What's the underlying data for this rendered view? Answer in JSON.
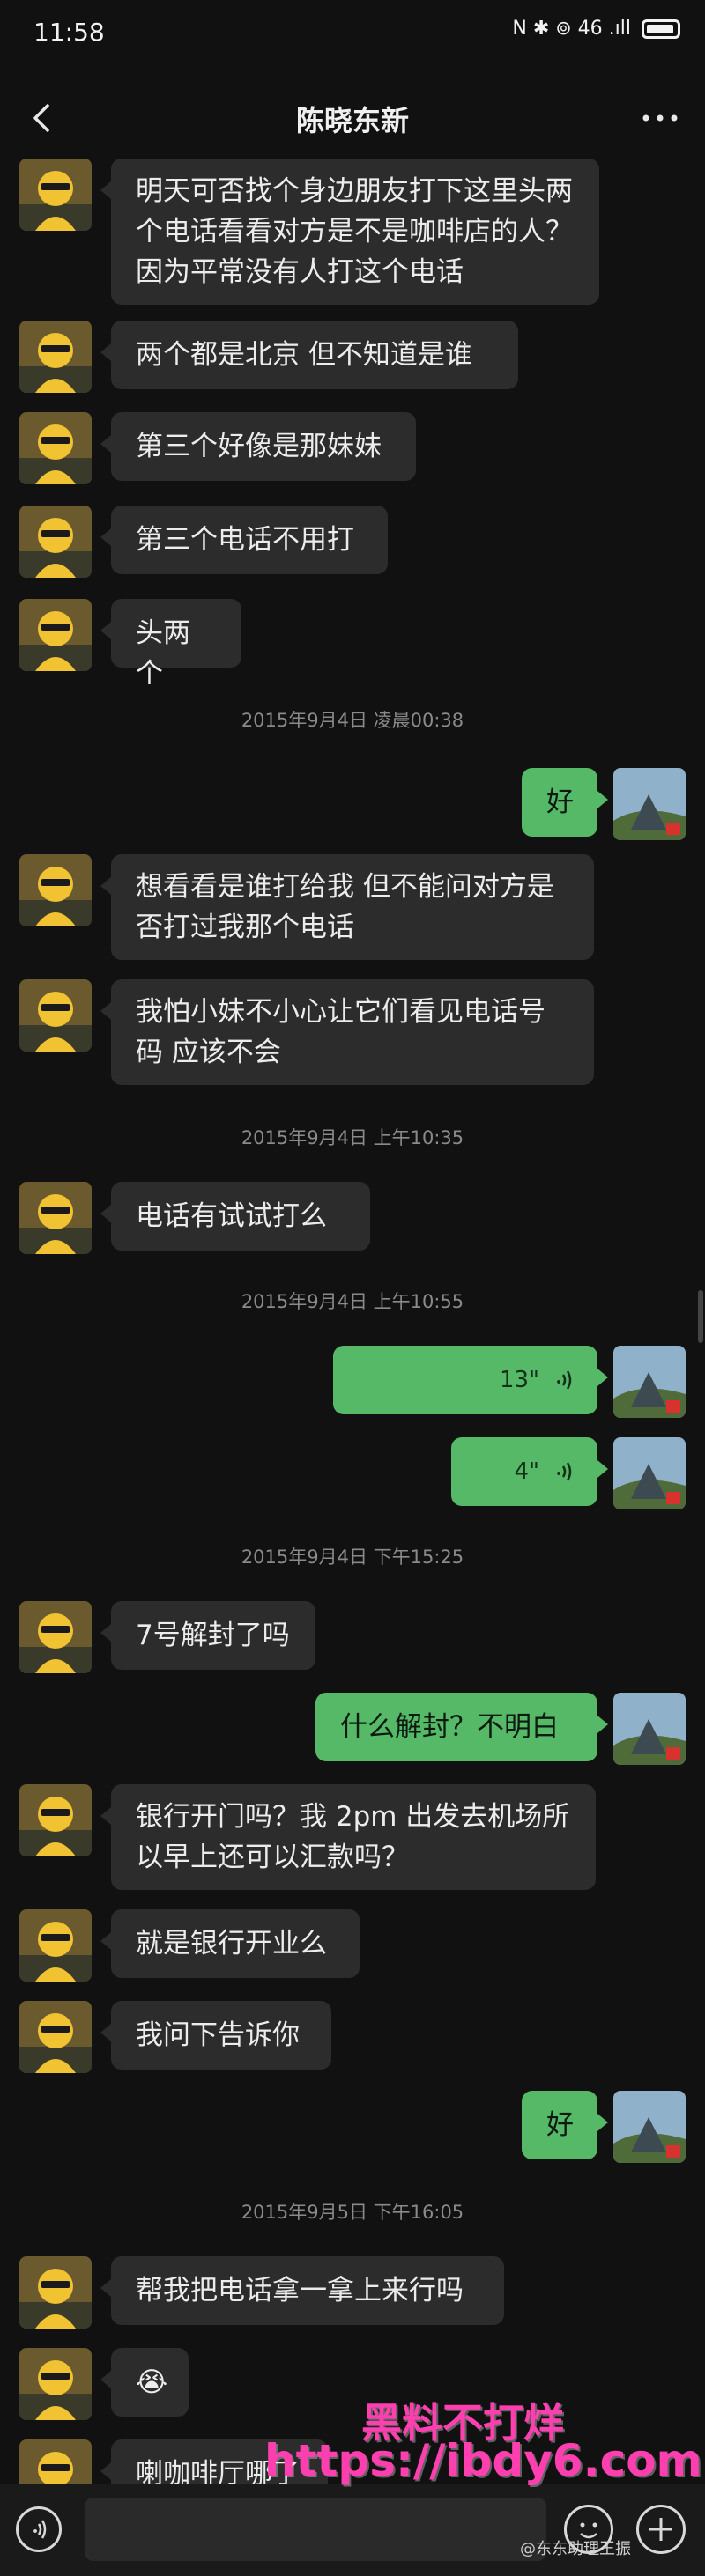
{
  "status": {
    "time": "11:58",
    "indicators": "N ✱ ⊚ 46 .ıll"
  },
  "header": {
    "title": "陈晓东新",
    "back_icon": "chevron-left-icon",
    "more_icon": "more-dots-icon"
  },
  "messages": [
    {
      "text": "明天可否找个身边朋友打下这里头两个电话看看对方是不是咖啡店的人？ 因为平常没有人打这个电话",
      "side": "left"
    },
    {
      "text": "两个都是北京  但不知道是谁",
      "side": "left"
    },
    {
      "text": "第三个好像是那妹妹",
      "side": "left"
    },
    {
      "text": "第三个电话不用打",
      "side": "left"
    },
    {
      "text": "头两个",
      "side": "left"
    },
    {
      "timestamp": "2015年9月4日  凌晨00:38"
    },
    {
      "text": "好",
      "side": "right"
    },
    {
      "text": "想看看是谁打给我  但不能问对方是否打过我那个电话",
      "side": "left"
    },
    {
      "text": "我怕小妹不小心让它们看见电话号码  应该不会",
      "side": "left"
    },
    {
      "timestamp": "2015年9月4日  上午10:35"
    },
    {
      "text": "电话有试试打么",
      "side": "left"
    },
    {
      "timestamp": "2015年9月4日  上午10:55"
    },
    {
      "voice": "13\"",
      "side": "right"
    },
    {
      "voice": "4\"",
      "side": "right"
    },
    {
      "timestamp": "2015年9月4日  下午15:25"
    },
    {
      "text": "7号解封了吗",
      "side": "left"
    },
    {
      "text": "什么解封？不明白",
      "side": "right"
    },
    {
      "text": "银行开门吗？我 2pm 出发去机场所以早上还可以汇款吗？",
      "side": "left"
    },
    {
      "text": "就是银行开业么",
      "side": "left"
    },
    {
      "text": "我问下告诉你",
      "side": "left"
    },
    {
      "text": "好",
      "side": "right"
    },
    {
      "timestamp": "2015年9月5日  下午16:05"
    },
    {
      "text": "帮我把电话拿一拿上来行吗",
      "side": "left"
    },
    {
      "text": "😭",
      "side": "left"
    },
    {
      "text": "喇咖啡厅哪了",
      "side": "left"
    }
  ],
  "input_bar": {
    "voice_icon": "voice-wave-icon",
    "emoji_icon": "emoji-face-icon",
    "plus_icon": "plus-icon",
    "placeholder": ""
  },
  "watermark": {
    "line1": "黑料不打烊",
    "line2": "https://ibdy6.com",
    "credit": "@东东助理王振"
  },
  "colors": {
    "background": "#111111",
    "left_bubble": "#2c2c2c",
    "right_bubble": "#55b968"
  }
}
